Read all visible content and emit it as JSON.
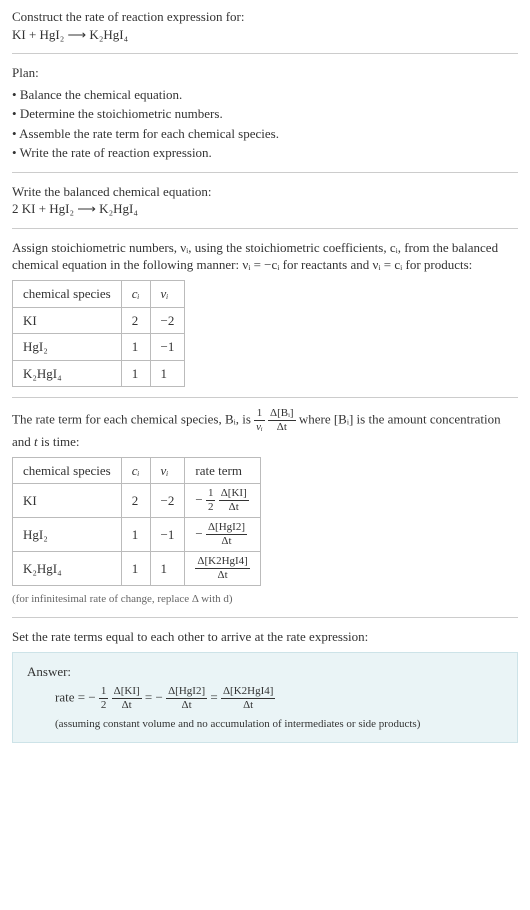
{
  "intro": {
    "title": "Construct the rate of reaction expression for:",
    "equation": "KI + HgI₂ ⟶ K₂HgI₄"
  },
  "plan": {
    "heading": "Plan:",
    "items": [
      "Balance the chemical equation.",
      "Determine the stoichiometric numbers.",
      "Assemble the rate term for each chemical species.",
      "Write the rate of reaction expression."
    ]
  },
  "balanced": {
    "heading": "Write the balanced chemical equation:",
    "equation": "2 KI + HgI₂ ⟶ K₂HgI₄"
  },
  "stoich_text": {
    "line1": "Assign stoichiometric numbers, νᵢ, using the stoichiometric coefficients, cᵢ, from the balanced chemical equation in the following manner: νᵢ = −cᵢ for reactants and νᵢ = cᵢ for products:"
  },
  "table1": {
    "headers": {
      "species": "chemical species",
      "c": "cᵢ",
      "v": "νᵢ"
    },
    "rows": [
      {
        "species": "KI",
        "c": "2",
        "v": "−2"
      },
      {
        "species": "HgI₂",
        "c": "1",
        "v": "−1"
      },
      {
        "species": "K₂HgI₄",
        "c": "1",
        "v": "1"
      }
    ]
  },
  "rate_term_text": {
    "pre": "The rate term for each chemical species, Bᵢ, is ",
    "mid": " where [Bᵢ] is the amount concentration and ",
    "tvar": "t",
    "post": " is time:"
  },
  "rate_frac1": {
    "num": "1",
    "den": "νᵢ"
  },
  "rate_frac2": {
    "num": "Δ[Bᵢ]",
    "den": "Δt"
  },
  "table2": {
    "headers": {
      "species": "chemical species",
      "c": "cᵢ",
      "v": "νᵢ",
      "rate": "rate term"
    },
    "rows": [
      {
        "species": "KI",
        "c": "2",
        "v": "−2",
        "rate_prefix": "−",
        "rate_coeff_num": "1",
        "rate_coeff_den": "2",
        "rate_num": "Δ[KI]",
        "rate_den": "Δt"
      },
      {
        "species": "HgI₂",
        "c": "1",
        "v": "−1",
        "rate_prefix": "−",
        "rate_coeff_num": "",
        "rate_coeff_den": "",
        "rate_num": "Δ[HgI2]",
        "rate_den": "Δt"
      },
      {
        "species": "K₂HgI₄",
        "c": "1",
        "v": "1",
        "rate_prefix": "",
        "rate_coeff_num": "",
        "rate_coeff_den": "",
        "rate_num": "Δ[K2HgI4]",
        "rate_den": "Δt"
      }
    ]
  },
  "note": "(for infinitesimal rate of change, replace Δ with d)",
  "final_heading": "Set the rate terms equal to each other to arrive at the rate expression:",
  "answer": {
    "label": "Answer:",
    "rate_lhs": "rate = −",
    "term1_coeff_num": "1",
    "term1_coeff_den": "2",
    "term1_num": "Δ[KI]",
    "term1_den": "Δt",
    "eq1": " = −",
    "term2_num": "Δ[HgI2]",
    "term2_den": "Δt",
    "eq2": " = ",
    "term3_num": "Δ[K2HgI4]",
    "term3_den": "Δt",
    "assumption": "(assuming constant volume and no accumulation of intermediates or side products)"
  },
  "chart_data": {
    "type": "table",
    "tables": [
      {
        "title": "Stoichiometric numbers",
        "columns": [
          "chemical species",
          "c_i",
          "ν_i"
        ],
        "rows": [
          [
            "KI",
            2,
            -2
          ],
          [
            "HgI2",
            1,
            -1
          ],
          [
            "K2HgI4",
            1,
            1
          ]
        ]
      },
      {
        "title": "Rate terms",
        "columns": [
          "chemical species",
          "c_i",
          "ν_i",
          "rate term"
        ],
        "rows": [
          [
            "KI",
            2,
            -2,
            "-(1/2) Δ[KI]/Δt"
          ],
          [
            "HgI2",
            1,
            -1,
            "- Δ[HgI2]/Δt"
          ],
          [
            "K2HgI4",
            1,
            1,
            "Δ[K2HgI4]/Δt"
          ]
        ]
      }
    ]
  }
}
